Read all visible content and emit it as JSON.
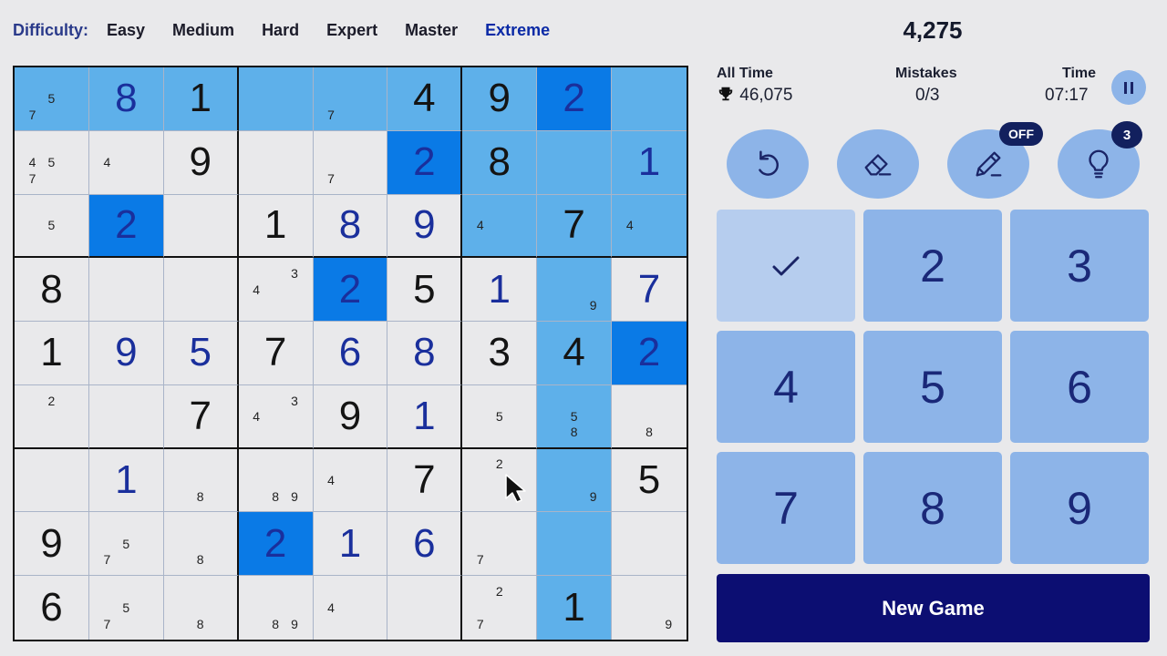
{
  "difficulty": {
    "label": "Difficulty:",
    "levels": [
      "Easy",
      "Medium",
      "Hard",
      "Expert",
      "Master",
      "Extreme"
    ],
    "active": "Extreme"
  },
  "score": "4,275",
  "stats": {
    "all_time_label": "All Time",
    "all_time_value": "46,075",
    "mistakes_label": "Mistakes",
    "mistakes_value": "0/3",
    "time_label": "Time",
    "time_value": "07:17"
  },
  "tools": {
    "undo_icon": "undo-icon",
    "erase_icon": "eraser-icon",
    "notes_icon": "pencil-icon",
    "notes_badge": "OFF",
    "hint_icon": "lightbulb-icon",
    "hint_badge": "3"
  },
  "numpad": {
    "keys": [
      "1",
      "2",
      "3",
      "4",
      "5",
      "6",
      "7",
      "8",
      "9"
    ],
    "completed": [
      "1"
    ],
    "completed_icon": "checkmark-icon"
  },
  "new_game_label": "New Game",
  "colors": {
    "highlight": "#5eb0ea",
    "selected_match": "#0a7ae6",
    "user_digit": "#1a2f9c",
    "given_digit": "#141414",
    "button_fill": "#8db4e8",
    "new_game_bg": "#0c0e72"
  },
  "grid": [
    [
      {
        "n": [
          5,
          7
        ]
      },
      {
        "v": 8,
        "t": "u"
      },
      {
        "v": 1,
        "t": "g"
      },
      {
        "n": []
      },
      {
        "n": [
          7
        ]
      },
      {
        "v": 4,
        "t": "g"
      },
      {
        "v": 9,
        "t": "g"
      },
      {
        "v": 2,
        "t": "u"
      },
      {
        "n": []
      }
    ],
    [
      {
        "n": [
          4,
          5,
          7
        ]
      },
      {
        "n": [
          4
        ]
      },
      {
        "v": 9,
        "t": "g"
      },
      {
        "n": []
      },
      {
        "n": [
          7
        ]
      },
      {
        "v": 2,
        "t": "u"
      },
      {
        "v": 8,
        "t": "g"
      },
      {
        "n": []
      },
      {
        "v": 1,
        "t": "u"
      }
    ],
    [
      {
        "n": [
          5
        ]
      },
      {
        "v": 2,
        "t": "u"
      },
      {
        "n": []
      },
      {
        "v": 1,
        "t": "g"
      },
      {
        "v": 8,
        "t": "u"
      },
      {
        "v": 9,
        "t": "u"
      },
      {
        "n": [
          4
        ]
      },
      {
        "v": 7,
        "t": "g"
      },
      {
        "n": [
          4
        ]
      }
    ],
    [
      {
        "v": 8,
        "t": "g"
      },
      {
        "n": []
      },
      {
        "n": []
      },
      {
        "n": [
          3,
          4
        ]
      },
      {
        "v": 2,
        "t": "u"
      },
      {
        "v": 5,
        "t": "g"
      },
      {
        "v": 1,
        "t": "u"
      },
      {
        "n": [
          9
        ]
      },
      {
        "v": 7,
        "t": "u"
      }
    ],
    [
      {
        "v": 1,
        "t": "g"
      },
      {
        "v": 9,
        "t": "u"
      },
      {
        "v": 5,
        "t": "u"
      },
      {
        "v": 7,
        "t": "g"
      },
      {
        "v": 6,
        "t": "u"
      },
      {
        "v": 8,
        "t": "u"
      },
      {
        "v": 3,
        "t": "g"
      },
      {
        "v": 4,
        "t": "g"
      },
      {
        "v": 2,
        "t": "u"
      }
    ],
    [
      {
        "n": [
          2
        ]
      },
      {
        "n": []
      },
      {
        "v": 7,
        "t": "g"
      },
      {
        "n": [
          3,
          4
        ]
      },
      {
        "v": 9,
        "t": "g"
      },
      {
        "v": 1,
        "t": "u"
      },
      {
        "n": [
          5
        ]
      },
      {
        "n": [
          5,
          8
        ]
      },
      {
        "n": [
          8
        ]
      }
    ],
    [
      {
        "n": []
      },
      {
        "v": 1,
        "t": "u"
      },
      {
        "n": [
          8
        ]
      },
      {
        "n": [
          8,
          9
        ]
      },
      {
        "n": [
          4
        ]
      },
      {
        "v": 7,
        "t": "g"
      },
      {
        "n": [
          2
        ]
      },
      {
        "n": [
          9
        ]
      },
      {
        "v": 5,
        "t": "g"
      }
    ],
    [
      {
        "v": 9,
        "t": "g"
      },
      {
        "n": [
          5,
          7
        ]
      },
      {
        "n": [
          8
        ]
      },
      {
        "v": 2,
        "t": "u"
      },
      {
        "v": 1,
        "t": "u"
      },
      {
        "v": 6,
        "t": "u"
      },
      {
        "n": [
          7
        ]
      },
      {
        "n": []
      },
      {
        "n": []
      }
    ],
    [
      {
        "v": 6,
        "t": "g"
      },
      {
        "n": [
          5,
          7
        ]
      },
      {
        "n": [
          8
        ]
      },
      {
        "n": [
          8,
          9
        ]
      },
      {
        "n": [
          4
        ]
      },
      {
        "n": []
      },
      {
        "n": [
          2,
          7
        ]
      },
      {
        "v": 1,
        "t": "g"
      },
      {
        "n": [
          9
        ]
      }
    ]
  ],
  "highlighted_cells": [
    [
      0,
      0
    ],
    [
      0,
      1
    ],
    [
      0,
      2
    ],
    [
      0,
      3
    ],
    [
      0,
      4
    ],
    [
      0,
      5
    ],
    [
      0,
      6
    ],
    [
      0,
      8
    ],
    [
      1,
      6
    ],
    [
      1,
      7
    ],
    [
      1,
      8
    ],
    [
      2,
      6
    ],
    [
      2,
      7
    ],
    [
      2,
      8
    ],
    [
      3,
      7
    ],
    [
      4,
      7
    ],
    [
      5,
      7
    ],
    [
      6,
      7
    ],
    [
      7,
      7
    ],
    [
      8,
      7
    ]
  ],
  "selected_cells": [
    [
      0,
      7
    ],
    [
      1,
      5
    ],
    [
      2,
      1
    ],
    [
      3,
      4
    ],
    [
      4,
      8
    ],
    [
      7,
      3
    ]
  ]
}
